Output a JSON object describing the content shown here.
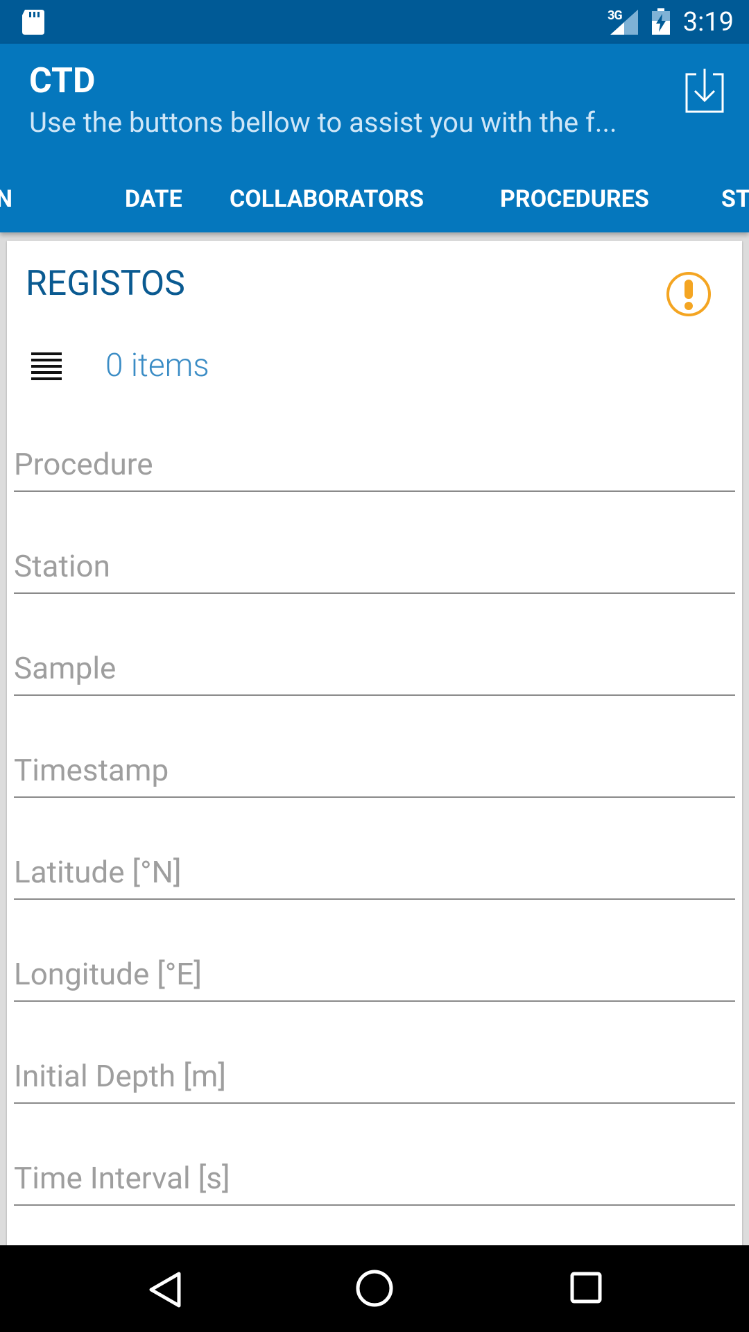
{
  "status_bar": {
    "network": "3G",
    "time": "3:19",
    "icons": [
      "sd-card-icon",
      "signal-icon",
      "battery-charging-icon"
    ]
  },
  "app_bar": {
    "title": "CTD",
    "subtitle": "Use the buttons bellow to assist you with the f...",
    "action_icon": "download-icon"
  },
  "tabs": [
    {
      "label": "N"
    },
    {
      "label": "DATE"
    },
    {
      "label": "COLLABORATORS"
    },
    {
      "label": "PROCEDURES"
    },
    {
      "label": "ST"
    }
  ],
  "card": {
    "title": "REGISTOS",
    "alert_icon": "alert-icon",
    "list_icon": "list-icon",
    "items_count": "0 items",
    "fields": [
      {
        "placeholder": "Procedure"
      },
      {
        "placeholder": "Station"
      },
      {
        "placeholder": "Sample"
      },
      {
        "placeholder": "Timestamp"
      },
      {
        "placeholder": "Latitude [°N]"
      },
      {
        "placeholder": "Longitude [°E]"
      },
      {
        "placeholder": "Initial Depth [m]"
      },
      {
        "placeholder": "Time Interval [s]"
      }
    ]
  },
  "nav_bar": {
    "icons": [
      "back-icon",
      "home-icon",
      "recents-icon"
    ]
  },
  "colors": {
    "status_bar": "#005a96",
    "app_bar": "#0577bd",
    "title_blue": "#0a5a91",
    "count_blue": "#3a8cc5",
    "alert": "#f4a522"
  }
}
